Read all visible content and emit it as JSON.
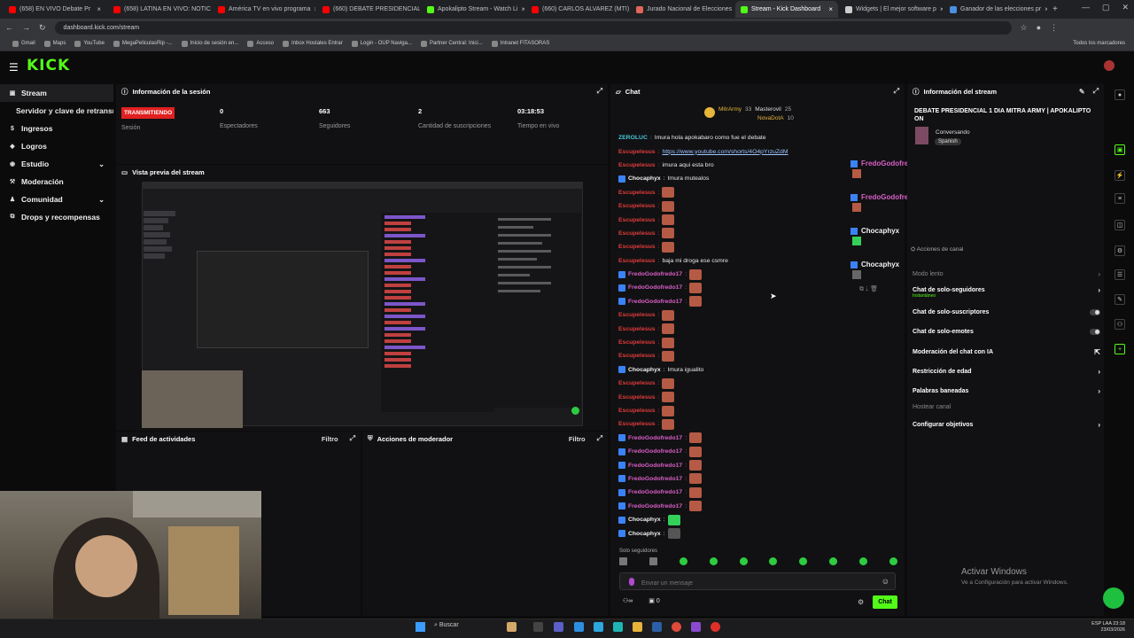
{
  "browser": {
    "tabs": [
      {
        "label": "(658) EN VIVO Debate Pr",
        "color": "#ff0000"
      },
      {
        "label": "(658) LATINA EN VIVO: NOTIC",
        "color": "#ff0000"
      },
      {
        "label": "América TV en vivo programa",
        "color": "#ff0000"
      },
      {
        "label": "(660) DEBATE PRESIDENCIAL",
        "color": "#ff0000"
      },
      {
        "label": "Apokalipto Stream - Watch Li",
        "color": "#53fc18"
      },
      {
        "label": "(660) CARLOS ALVAREZ (MTI)",
        "color": "#ff0000"
      },
      {
        "label": "Jurado Nacional de Elecciones",
        "color": "#e0665a"
      },
      {
        "label": "Stream - Kick Dashboard",
        "color": "#53fc18",
        "active": true
      },
      {
        "label": "Widgets | El mejor software p",
        "color": "#cccccc"
      },
      {
        "label": "Ganador de las elecciones pr",
        "color": "#4a90e2"
      }
    ],
    "url": "dashboard.kick.com/stream",
    "bookmarks": [
      "Gmail",
      "Maps",
      "YouTube",
      "MegaPeliculasRip -...",
      "Inicio de sesión en...",
      "Acceso",
      "Inbox Hostales Entrar",
      "Login - OUP Naviga...",
      "Partner Central: Inici...",
      "Intranet FITASORAS"
    ],
    "all_bookmarks": "Todos los marcadores"
  },
  "kick": {
    "logo": "KICK",
    "sidebar": {
      "stream": "Stream",
      "server_key": "Servidor y clave de retransm",
      "items": [
        {
          "label": "Ingresos",
          "icon": "$"
        },
        {
          "label": "Logros",
          "icon": "◆"
        },
        {
          "label": "Estudio",
          "icon": "◉",
          "chevron": true
        },
        {
          "label": "Moderación",
          "icon": "⚒"
        },
        {
          "label": "Comunidad",
          "icon": "♟",
          "chevron": true
        },
        {
          "label": "Drops y recompensas",
          "icon": "⧉"
        }
      ]
    },
    "session": {
      "title": "Información de la sesión",
      "badge": "TRANSMITIENDO",
      "label": "Sesión",
      "stats": [
        {
          "value": "0",
          "label": "Espectadores"
        },
        {
          "value": "663",
          "label": "Seguidores"
        },
        {
          "value": "2",
          "label": "Cantidad de suscripciones"
        },
        {
          "value": "03:18:53",
          "label": "Tiempo en vivo"
        }
      ]
    },
    "preview": {
      "title": "Vista previa del stream"
    },
    "activity": {
      "title": "Feed de actividades",
      "filter": "Filtro"
    },
    "modactions": {
      "title": "Acciones de moderador",
      "filter": "Filtro"
    },
    "chat": {
      "title": "Chat",
      "pinned": [
        {
          "name": "MitrArmy",
          "count": "33",
          "name2": "Masterovil",
          "count2": "25"
        },
        {
          "name": "",
          "count": "",
          "name2": "NovaDotA",
          "count2": "10"
        }
      ],
      "lines": [
        {
          "user": "ZEROLUC",
          "cls": "u-teal",
          "msg": "Imura hola apokabaro como fue el debate"
        },
        {
          "user": "Escupelesus",
          "cls": "u-red",
          "msg": "https://www.youtube.com/shorts/4O4pYrzuZdM",
          "link": true
        },
        {
          "user": "Escupelesus",
          "cls": "u-red",
          "msg": "imura aqui esta bro"
        },
        {
          "user": "Chocaphyx",
          "cls": "u-white",
          "msg": "Imura mutealos",
          "badge": true
        },
        {
          "user": "Escupelesus",
          "cls": "u-red",
          "emote": true
        },
        {
          "user": "Escupelesus",
          "cls": "u-red",
          "emote": true
        },
        {
          "user": "Escupelesus",
          "cls": "u-red",
          "emote": true
        },
        {
          "user": "Escupelesus",
          "cls": "u-red",
          "emote": true
        },
        {
          "user": "Escupelesus",
          "cls": "u-red",
          "emote": true
        },
        {
          "user": "Escupelesus",
          "cls": "u-red",
          "msg": "baja mi droga ese csmre"
        },
        {
          "user": "FredoGodofredo17",
          "cls": "u-pink",
          "emote": true,
          "badge": true
        },
        {
          "user": "FredoGodofredo17",
          "cls": "u-pink",
          "emote": true,
          "badge": true
        },
        {
          "user": "FredoGodofredo17",
          "cls": "u-pink",
          "emote": true,
          "badge": true
        },
        {
          "user": "Escupelesus",
          "cls": "u-red",
          "emote": true
        },
        {
          "user": "Escupelesus",
          "cls": "u-red",
          "emote": true
        },
        {
          "user": "Escupelesus",
          "cls": "u-red",
          "emote": true
        },
        {
          "user": "Escupelesus",
          "cls": "u-red",
          "emote": true
        },
        {
          "user": "Chocaphyx",
          "cls": "u-white",
          "msg": "Imura igualito",
          "badge": true
        },
        {
          "user": "Escupelesus",
          "cls": "u-red",
          "emote": true
        },
        {
          "user": "Escupelesus",
          "cls": "u-red",
          "emote": true
        },
        {
          "user": "Escupelesus",
          "cls": "u-red",
          "emote": true
        },
        {
          "user": "Escupelesus",
          "cls": "u-red",
          "emote": true
        },
        {
          "user": "FredoGodofredo17",
          "cls": "u-pink",
          "emote": true,
          "badge": true
        },
        {
          "user": "FredoGodofredo17",
          "cls": "u-pink",
          "emote": true,
          "badge": true
        },
        {
          "user": "FredoGodofredo17",
          "cls": "u-pink",
          "emote": true,
          "badge": true
        },
        {
          "user": "FredoGodofredo17",
          "cls": "u-pink",
          "emote": true,
          "badge": true
        },
        {
          "user": "FredoGodofredo17",
          "cls": "u-pink",
          "emote": true,
          "badge": true
        },
        {
          "user": "FredoGodofredo17",
          "cls": "u-pink",
          "emote": true,
          "badge": true
        },
        {
          "user": "Chocaphyx",
          "cls": "u-white",
          "emote": "g",
          "badge": true
        },
        {
          "user": "Chocaphyx",
          "cls": "u-white",
          "emote": "c",
          "badge": true
        }
      ],
      "solo": "Solo seguidores",
      "placeholder": "Enviar un mensaje",
      "send": "Chat",
      "footer_count": "0",
      "popout_users": [
        "FredoGodofredo17",
        "FredoGodofredo17",
        "Chocaphyx",
        "Chocaphyx"
      ]
    },
    "info": {
      "title": "Información del stream",
      "stream_title": "DEBATE PRESIDENCIAL 1 DIA MITRA ARMY | APOKALIPTO ON",
      "category": "Conversando",
      "language": "Spanish"
    },
    "channel_actions": {
      "title": "Acciones de canal",
      "items": [
        {
          "label": "Modo lento",
          "dim": true,
          "right": "chevron"
        },
        {
          "label": "Chat de solo-seguidores",
          "sub": "Instantáneo",
          "right": "chevron"
        },
        {
          "label": "Chat de solo-suscriptores",
          "right": "toggle"
        },
        {
          "label": "Chat de solo-emotes",
          "right": "toggle"
        },
        {
          "label": "Moderación del chat con IA",
          "right": "ext"
        },
        {
          "label": "Restricción de edad",
          "right": "chevron"
        },
        {
          "label": "Palabras baneadas",
          "right": "chevron"
        },
        {
          "label": "Hostear canal",
          "dim": true,
          "right": ""
        },
        {
          "label": "Configurar objetivos",
          "right": "chevron"
        }
      ]
    },
    "watermark": {
      "title": "Activar Windows",
      "sub": "Ve a Configuración para activar Windows."
    }
  },
  "taskbar": {
    "search": "Buscar",
    "tray_lang": "ESP LAA",
    "time": "23:18",
    "date": "23/03/2026"
  }
}
